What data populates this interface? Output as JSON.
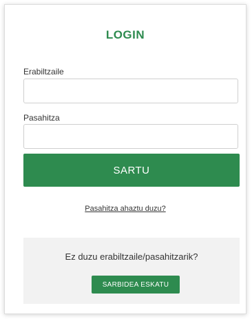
{
  "login": {
    "title": "LOGIN",
    "username_label": "Erabiltzaile",
    "username_value": "",
    "password_label": "Pasahitza",
    "password_value": "",
    "submit_label": "SARTU",
    "forgot_link": "Pasahitza ahaztu duzu?"
  },
  "request_access": {
    "prompt": "Ez duzu erabiltzaile/pasahitzarik?",
    "button_label": "SARBIDEA ESKATU"
  },
  "colors": {
    "accent": "#2e8b4f",
    "panel_background": "#f2f2f2"
  }
}
